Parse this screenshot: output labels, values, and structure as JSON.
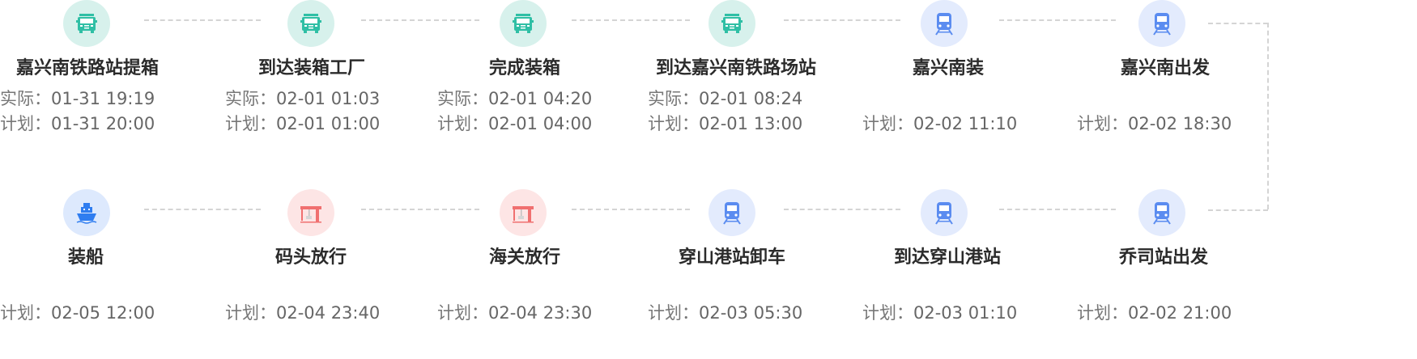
{
  "timeline": {
    "row1": [
      {
        "title": "嘉兴南铁路站提箱",
        "icon": "truck-icon",
        "actual_label": "实际：",
        "actual": "01-31 19:19",
        "plan_label": "计划：",
        "plan": "01-31 20:00"
      },
      {
        "title": "到达装箱工厂",
        "icon": "truck-icon",
        "actual_label": "实际：",
        "actual": "02-01 01:03",
        "plan_label": "计划：",
        "plan": "02-01 01:00"
      },
      {
        "title": "完成装箱",
        "icon": "truck-icon",
        "actual_label": "实际：",
        "actual": "02-01 04:20",
        "plan_label": "计划：",
        "plan": "02-01 04:00"
      },
      {
        "title": "到达嘉兴南铁路场站",
        "icon": "truck-icon",
        "actual_label": "实际：",
        "actual": "02-01 08:24",
        "plan_label": "计划：",
        "plan": "02-01 13:00"
      },
      {
        "title": "嘉兴南装",
        "icon": "train-icon",
        "plan_label": "计划：",
        "plan": "02-02 11:10"
      },
      {
        "title": "嘉兴南出发",
        "icon": "train-icon",
        "plan_label": "计划：",
        "plan": "02-02 18:30"
      }
    ],
    "row2": [
      {
        "title": "装船",
        "icon": "ship-icon",
        "plan_label": "计划：",
        "plan": "02-05 12:00"
      },
      {
        "title": "码头放行",
        "icon": "crane-icon",
        "plan_label": "计划：",
        "plan": "02-04 23:40"
      },
      {
        "title": "海关放行",
        "icon": "crane-icon",
        "plan_label": "计划：",
        "plan": "02-04 23:30"
      },
      {
        "title": "穿山港站卸车",
        "icon": "train-icon",
        "plan_label": "计划：",
        "plan": "02-03 05:30"
      },
      {
        "title": "到达穿山港站",
        "icon": "train-icon",
        "plan_label": "计划：",
        "plan": "02-03 01:10"
      },
      {
        "title": "乔司站出发",
        "icon": "train-icon",
        "plan_label": "计划：",
        "plan": "02-02 21:00"
      }
    ]
  },
  "colors": {
    "truck_bg": "#d7f1ec",
    "truck_fg": "#2fbfa5",
    "train_bg": "#e3ebfd",
    "train_fg": "#5b8cf0",
    "ship_bg": "#dde9fd",
    "ship_fg": "#2f7df0",
    "crane_bg": "#fde5e5",
    "crane_fg": "#f07070",
    "connector": "#d4d4d4"
  }
}
